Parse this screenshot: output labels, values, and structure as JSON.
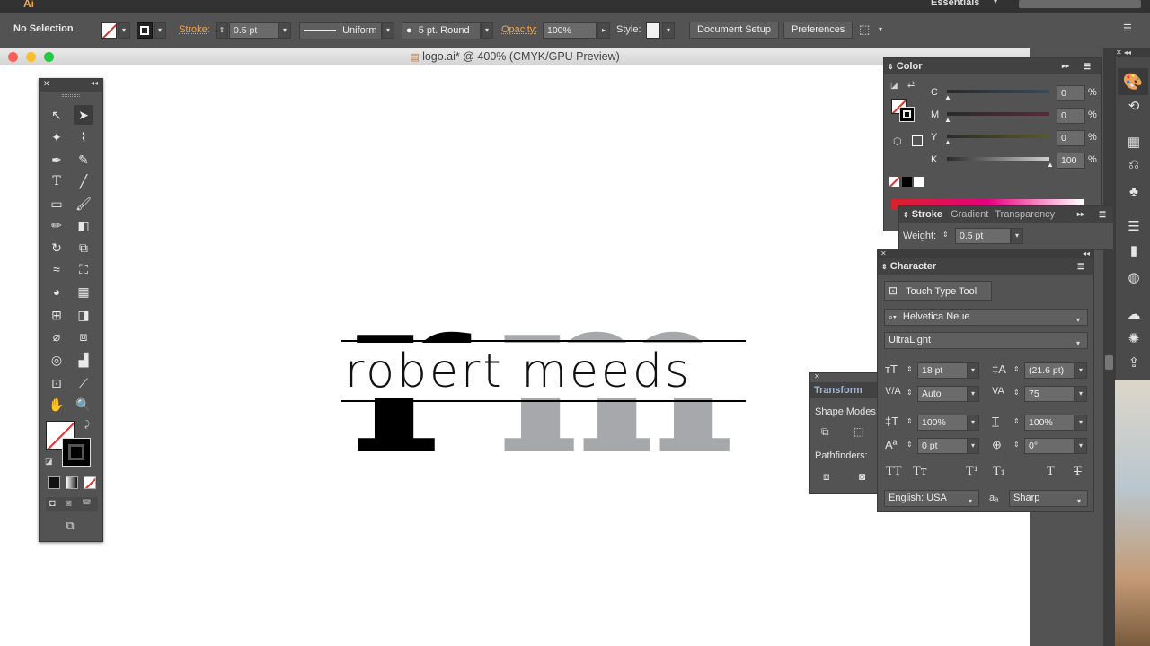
{
  "topbar": {
    "app_icon": "Ai",
    "workspace": "Essentials"
  },
  "control": {
    "selection": "No Selection",
    "stroke_label": "Stroke:",
    "stroke_value": "0.5 pt",
    "profile": "Uniform",
    "brush": "5 pt. Round",
    "opacity_label": "Opacity:",
    "opacity_value": "100%",
    "style_label": "Style:",
    "document_setup": "Document Setup",
    "preferences": "Preferences"
  },
  "document": {
    "title": "logo.ai* @ 400% (CMYK/GPU Preview)",
    "logo_letters": "rm",
    "logo_name": "robert meeds",
    "colors": {
      "r": "#000000",
      "m": "#a7a8ac"
    }
  },
  "color_panel": {
    "title": "Color",
    "channels": [
      {
        "label": "C",
        "value": "0",
        "unit": "%",
        "fill": 0,
        "bar": "#3b4a5a"
      },
      {
        "label": "M",
        "value": "0",
        "unit": "%",
        "fill": 0,
        "bar": "#5a2a3a"
      },
      {
        "label": "Y",
        "value": "0",
        "unit": "%",
        "fill": 0,
        "bar": "#5a5a2a"
      },
      {
        "label": "K",
        "value": "100",
        "unit": "%",
        "fill": 1,
        "bar": "#d0d0d0"
      }
    ]
  },
  "stroke_panel": {
    "tabs": [
      "Stroke",
      "Gradient",
      "Transparency"
    ],
    "weight_label": "Weight:",
    "weight_value": "0.5 pt"
  },
  "character_panel": {
    "title": "Character",
    "touch_type": "Touch Type Tool",
    "font_family": "Helvetica Neue",
    "font_style": "UltraLight",
    "size": "18 pt",
    "leading": "(21.6 pt)",
    "kerning": "Auto",
    "tracking": "75",
    "vscale": "100%",
    "hscale": "100%",
    "baseline": "0 pt",
    "rotation": "0°",
    "language": "English: USA",
    "aa_label": "aa",
    "antialias": "Sharp"
  },
  "transform_panel": {
    "title": "Transform",
    "shape_modes": "Shape Modes:",
    "pathfinders": "Pathfinders:"
  }
}
